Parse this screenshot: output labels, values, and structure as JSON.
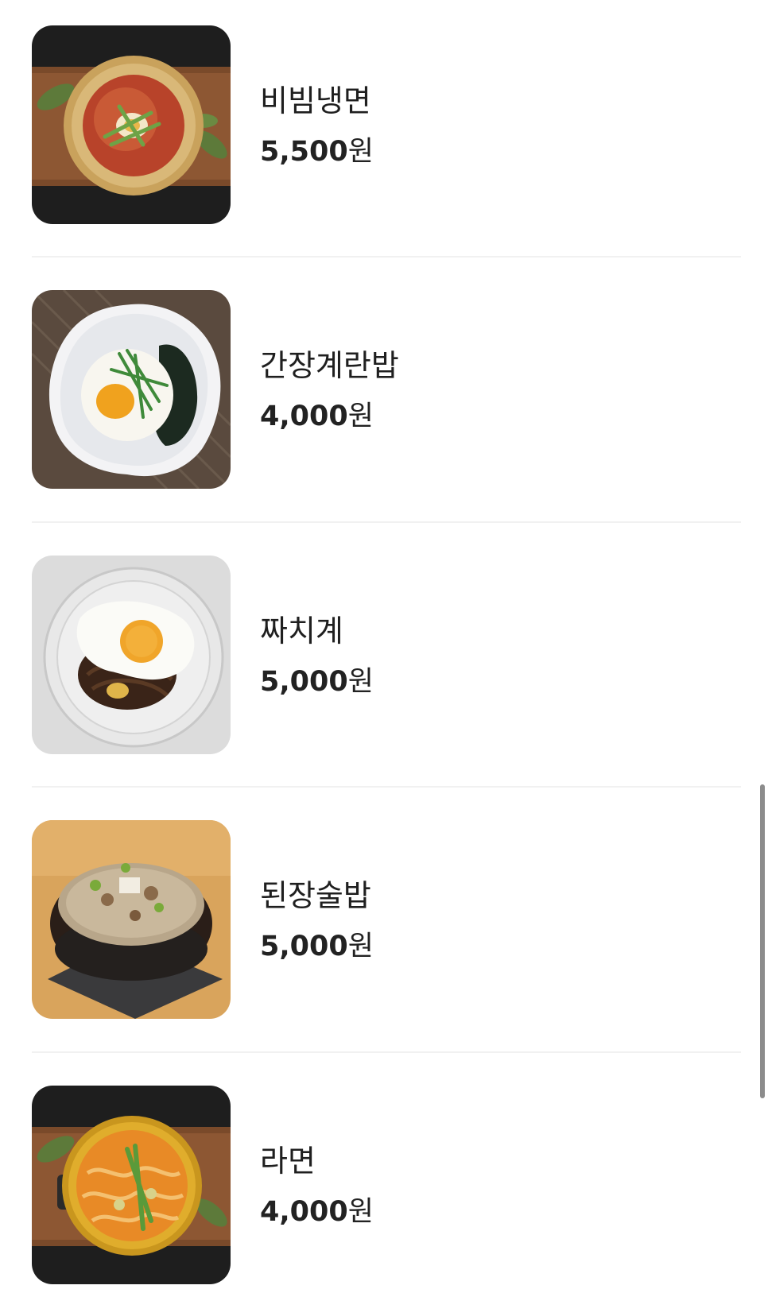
{
  "menu": {
    "items": [
      {
        "name": "비빔냉면",
        "price": "5,500",
        "currency": "원",
        "image": "bibim-naengmyeon-photo"
      },
      {
        "name": "간장계란밥",
        "price": "4,000",
        "currency": "원",
        "image": "soy-egg-rice-photo"
      },
      {
        "name": "짜치계",
        "price": "5,000",
        "currency": "원",
        "image": "jjachigye-photo"
      },
      {
        "name": "된장술밥",
        "price": "5,000",
        "currency": "원",
        "image": "doenjang-sulbap-photo"
      },
      {
        "name": "라면",
        "price": "4,000",
        "currency": "원",
        "image": "ramen-photo"
      }
    ]
  },
  "colors": {
    "text": "#1f1f1f",
    "divider": "#f1f1f1",
    "scrollbar": "#8c8c8c"
  }
}
